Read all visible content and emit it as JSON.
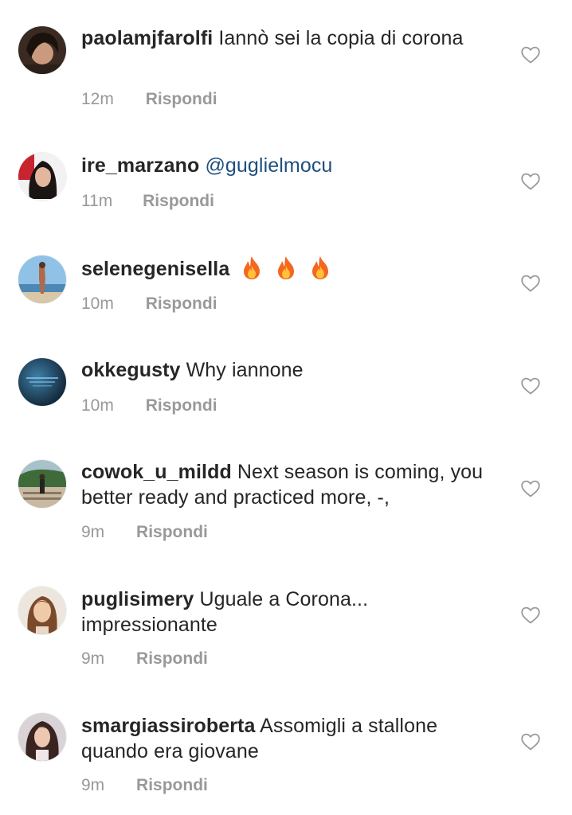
{
  "comments": [
    {
      "username": "paolamjfarolfi",
      "text": "Iannò sei la copia di corona",
      "time": "12m",
      "reply_label": "Rispondi",
      "like_icon": "heart-outline-icon"
    },
    {
      "username": "ire_marzano",
      "mention": "@guglielmocu",
      "time": "11m",
      "reply_label": "Rispondi",
      "like_icon": "heart-outline-icon"
    },
    {
      "username": "selenegenisella",
      "emoji": [
        "fire-icon",
        "fire-icon",
        "fire-icon"
      ],
      "time": "10m",
      "reply_label": "Rispondi",
      "like_icon": "heart-outline-icon"
    },
    {
      "username": "okkegusty",
      "text": "Why iannone",
      "time": "10m",
      "reply_label": "Rispondi",
      "like_icon": "heart-outline-icon"
    },
    {
      "username": "cowok_u_mildd",
      "text": "Next season is coming, you better ready and practiced more, -,",
      "time": "9m",
      "reply_label": "Rispondi",
      "like_icon": "heart-outline-icon"
    },
    {
      "username": "puglisimery",
      "text": "Uguale a Corona... impressionante",
      "time": "9m",
      "reply_label": "Rispondi",
      "like_icon": "heart-outline-icon"
    },
    {
      "username": "smargiassiroberta",
      "text": "Assomigli a stallone quando era giovane",
      "time": "9m",
      "reply_label": "Rispondi",
      "like_icon": "heart-outline-icon"
    }
  ],
  "colors": {
    "text": "#262626",
    "meta": "#999999",
    "mention": "#1e4f7e",
    "background": "#ffffff"
  }
}
